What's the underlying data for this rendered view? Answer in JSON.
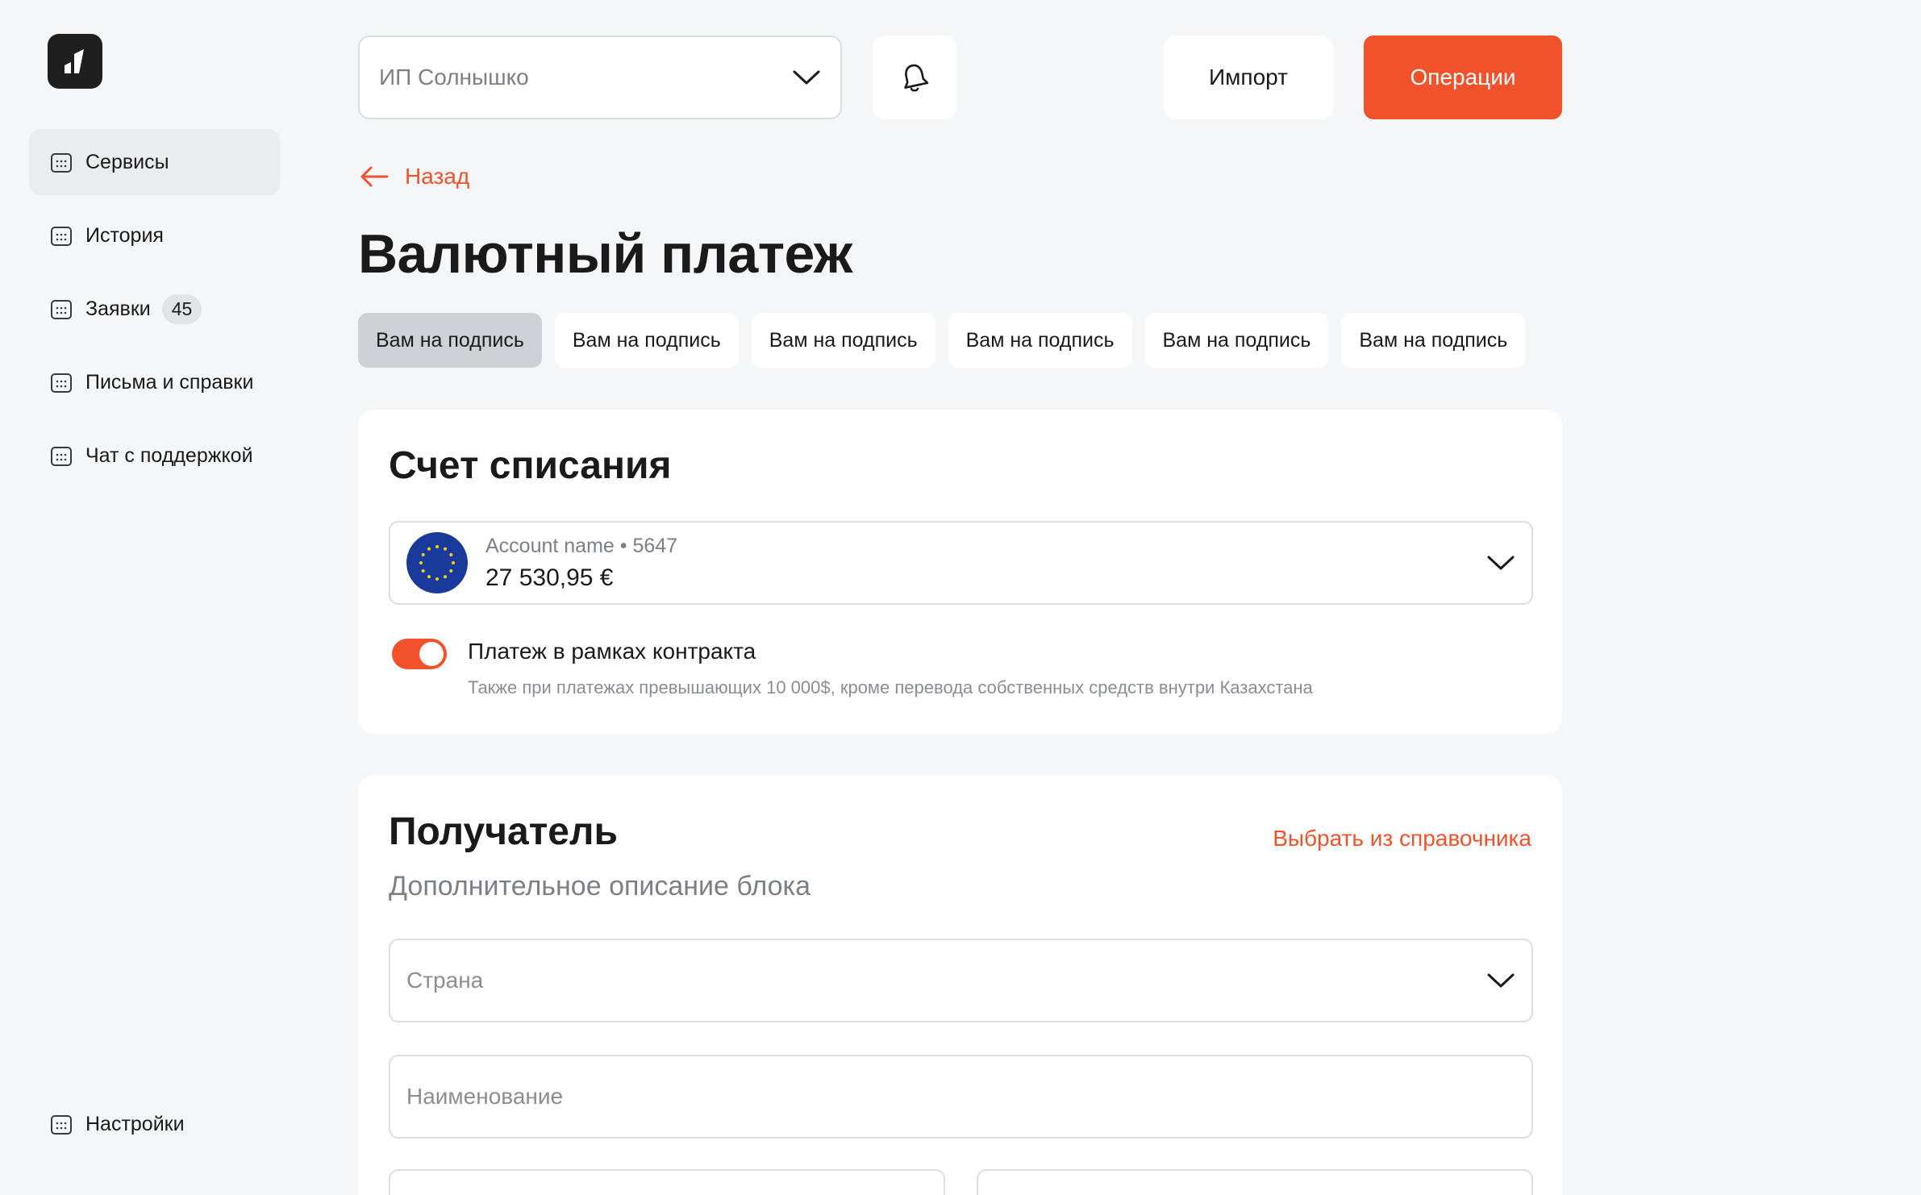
{
  "sidebar": {
    "items": [
      {
        "label": "Сервисы"
      },
      {
        "label": "История"
      },
      {
        "label": "Заявки",
        "badge": "45"
      },
      {
        "label": "Письма и справки"
      },
      {
        "label": "Чат с поддержкой"
      }
    ],
    "settings_label": "Настройки"
  },
  "topbar": {
    "company": "ИП Солнышко",
    "import_label": "Импорт",
    "operations_label": "Операции"
  },
  "page": {
    "back_label": "Назад",
    "title": "Валютный платеж"
  },
  "tabs": [
    {
      "label": "Вам на подпись"
    },
    {
      "label": "Вам на подпись"
    },
    {
      "label": "Вам на подпись"
    },
    {
      "label": "Вам на подпись"
    },
    {
      "label": "Вам на подпись"
    },
    {
      "label": "Вам на подпись"
    }
  ],
  "debit": {
    "title": "Счет списания",
    "account_name": "Account name • 5647",
    "amount": "27 530,95 €",
    "toggle_label": "Платеж в рамках контракта",
    "toggle_on": true,
    "hint": "Также при платежах превышающих 10 000$, кроме перевода собственных средств внутри Казахстана"
  },
  "recipient": {
    "title": "Получатель",
    "subtitle": "Дополнительное описание блока",
    "dictionary_link": "Выбрать из справочника",
    "country_placeholder": "Страна",
    "name_placeholder": "Наименование"
  },
  "colors": {
    "accent": "#f0532b",
    "background": "#f5f6f8"
  }
}
